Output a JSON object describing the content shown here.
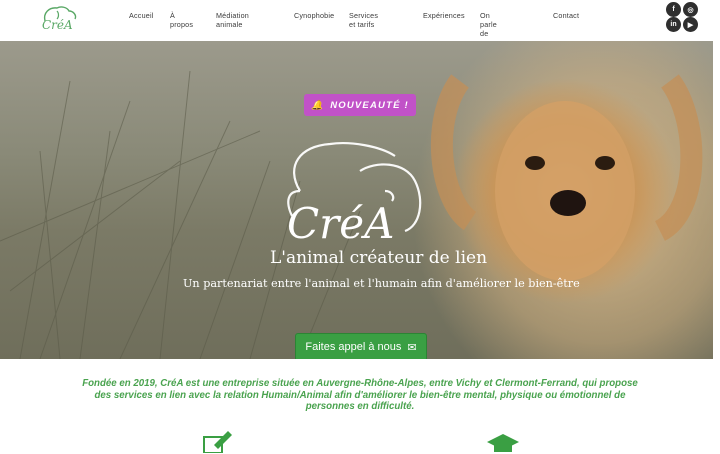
{
  "header": {
    "logo_text": "CréA",
    "nav": [
      "Accueil",
      "À propos",
      "Médiation animale",
      "Cynophobie",
      "Services et tarifs",
      "Expériences",
      "On parle de nous",
      "Contact"
    ],
    "social": [
      "facebook-icon",
      "instagram-icon",
      "linkedin-icon",
      "youtube-icon"
    ]
  },
  "hero": {
    "badge": "NOUVEAUTÉ !",
    "brand": "CréA",
    "title": "L'animal créateur de lien",
    "subtitle": "Un partenariat entre l'animal et l'humain afin d'améliorer le bien-être",
    "cta": "Faites appel à nous"
  },
  "intro": {
    "text": "Fondée en 2019, CréA est une entreprise située en Auvergne-Rhône-Alpes, entre Vichy et Clermont-Ferrand, qui propose des services en lien avec la relation Humain/Animal afin d'améliorer le bien-être mental, physique ou émotionnel de personnes en difficulté."
  },
  "colors": {
    "accent_green": "#3a9f43",
    "badge_purple": "#c152c8",
    "text_green": "#4aa34f"
  }
}
